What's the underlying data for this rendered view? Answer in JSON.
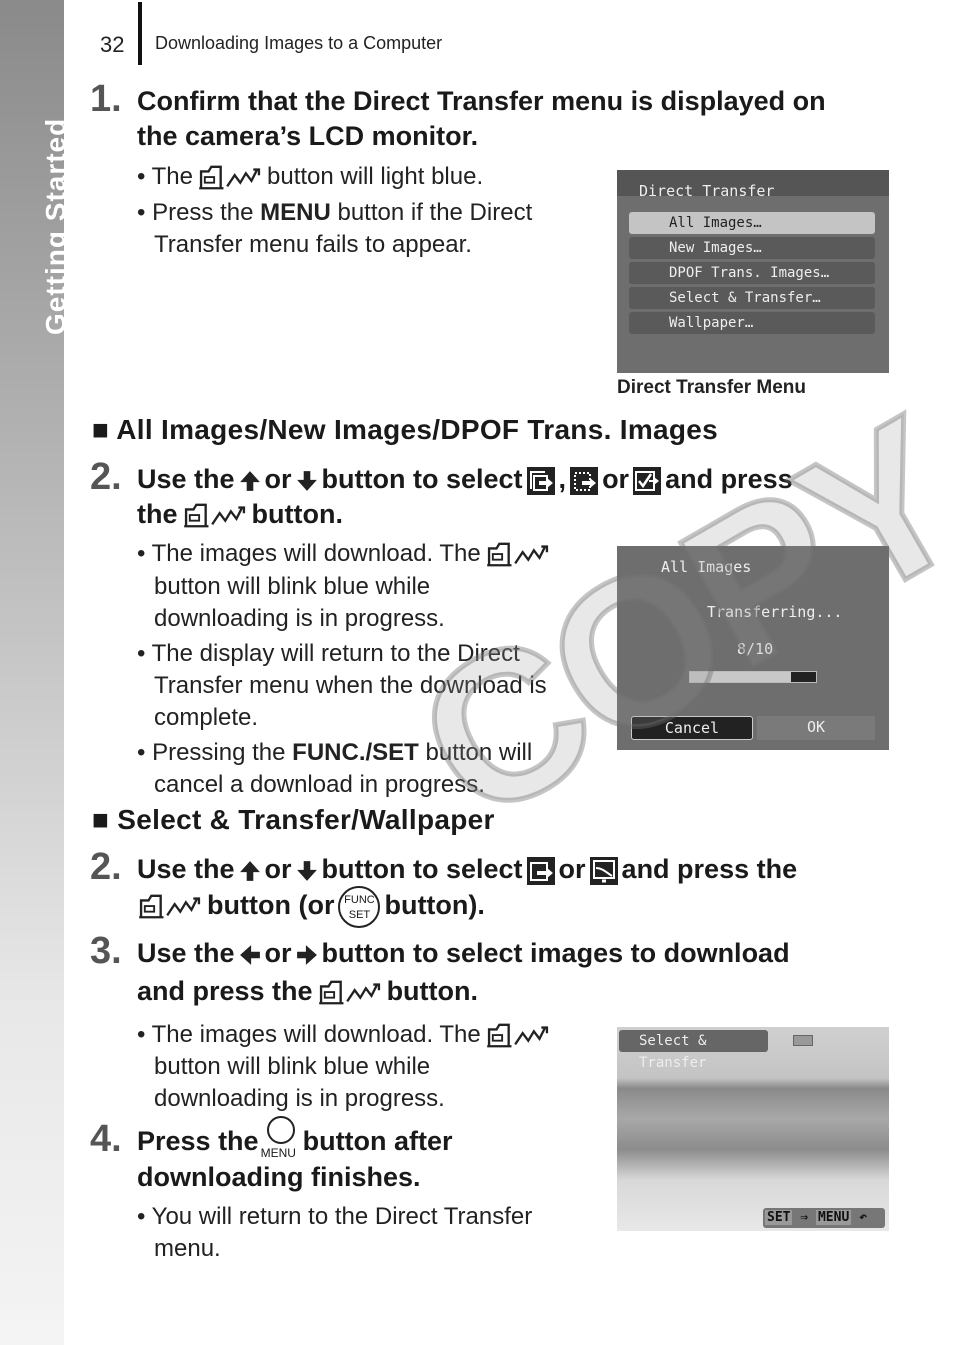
{
  "sidebar": {
    "label": "Getting Started"
  },
  "header": {
    "page_number": "32",
    "breadcrumb": "Downloading Images to a Computer"
  },
  "step1": {
    "number": "1.",
    "line1": "Confirm that the Direct Transfer menu is displayed on",
    "line2": "the camera’s LCD monitor.",
    "b1a": "The",
    "b1b": "button will light blue.",
    "b2a": "Press the ",
    "b2bold": "MENU",
    "b2b": " button if the Direct",
    "b2c": "Transfer menu fails to appear."
  },
  "lcd1": {
    "title": "Direct Transfer",
    "items": [
      "All Images…",
      "New Images…",
      "DPOF Trans. Images…",
      "Select & Transfer…",
      "Wallpaper…"
    ],
    "caption": "Direct Transfer Menu"
  },
  "section1": {
    "title": "All Images/New Images/DPOF Trans. Images"
  },
  "step2": {
    "number": "2.",
    "a": "Use the",
    "or1": "or",
    "b": "button to select",
    "comma": ",",
    "or2": "or",
    "c": "and press",
    "d": "the",
    "e": "button.",
    "b1a": "The images will download. The",
    "b1b": "button will blink blue while",
    "b1c": "downloading is in progress.",
    "b2a": "The display will return to the Direct",
    "b2b": "Transfer menu when the download is",
    "b2c": "complete.",
    "b3a": "Pressing the ",
    "b3bold": "FUNC./SET",
    "b3b": " button will",
    "b3c": "cancel a download in progress."
  },
  "lcd2": {
    "title": "All Images",
    "status": "Transferring...",
    "count": "8/10",
    "progress": 0.8,
    "cancel": "Cancel",
    "ok": "OK"
  },
  "section2": {
    "title": "Select & Transfer/Wallpaper"
  },
  "step2b": {
    "number": "2.",
    "a": "Use the",
    "or1": "or",
    "b": "button to select",
    "or2": "or",
    "c": "and press the",
    "d": "button (or",
    "e": "button).",
    "func": "FUNC",
    "set": "SET"
  },
  "step3": {
    "number": "3.",
    "a": "Use the",
    "or1": "or",
    "b": "button to select images to download",
    "c": "and press the",
    "d": "button.",
    "b1a": "The images will download. The",
    "b1b": "button will blink blue while",
    "b1c": "downloading is in progress."
  },
  "lcd3": {
    "title": "Select & Transfer",
    "set": "SET",
    "menu": "MENU"
  },
  "step4": {
    "number": "4.",
    "a": "Press the",
    "menu": "MENU",
    "b": "button after",
    "c": "downloading finishes.",
    "b1a": "You will return to the Direct Transfer",
    "b1b": "menu."
  },
  "watermark": "COPY"
}
